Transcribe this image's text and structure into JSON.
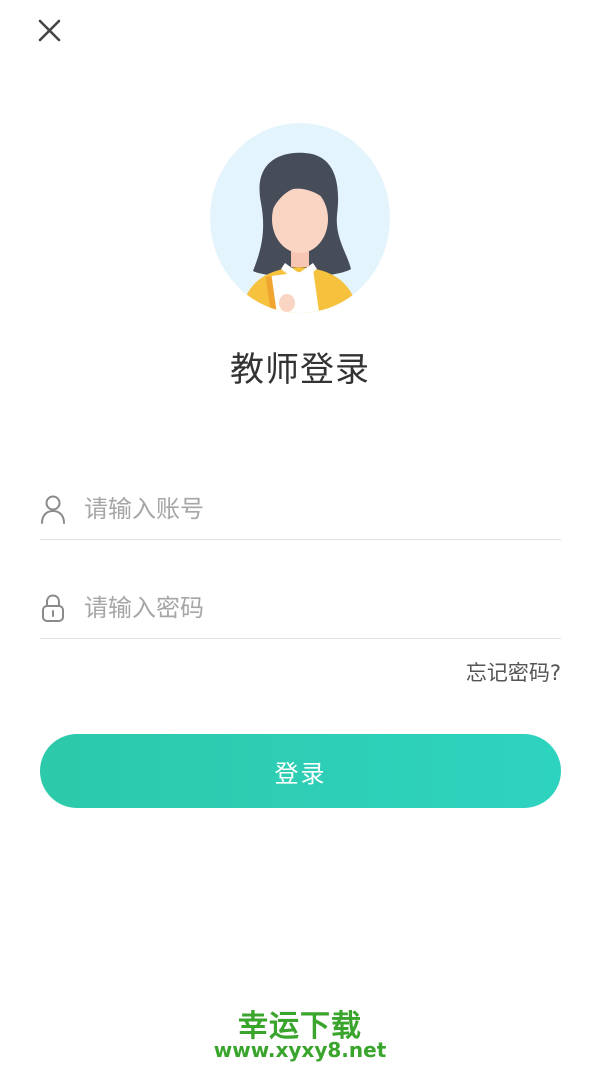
{
  "header": {
    "close_icon": "close-icon"
  },
  "avatar": {
    "icon": "teacher-avatar"
  },
  "login": {
    "title": "教师登录",
    "account_placeholder": "请输入账号",
    "account_value": "",
    "account_icon": "user-icon",
    "password_placeholder": "请输入密码",
    "password_value": "",
    "password_icon": "lock-icon",
    "forgot_password": "忘记密码?",
    "submit_label": "登录"
  },
  "watermark": {
    "title": "幸运下载",
    "url": "www.xyxy8.net"
  },
  "colors": {
    "accent": "#2ecab3",
    "watermark": "#3aa52c",
    "avatar_bg": "#e3f4fc"
  }
}
